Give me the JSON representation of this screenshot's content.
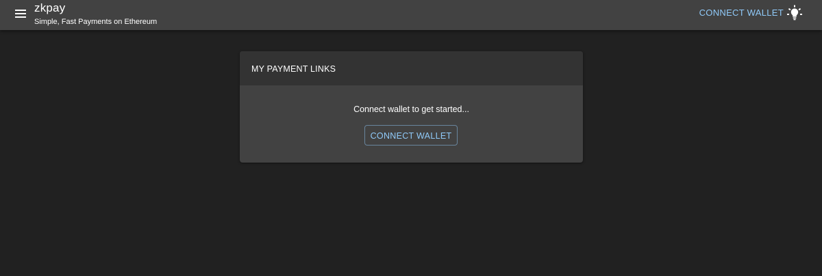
{
  "app": {
    "title": "zkpay",
    "subtitle": "Simple, Fast Payments on Ethereum"
  },
  "header": {
    "menu_icon": "hamburger-menu-icon",
    "connect_label": "CONNECT WALLET",
    "theme_icon": "lightbulb-icon"
  },
  "card": {
    "title": "MY PAYMENT LINKS",
    "prompt": "Connect wallet to get started...",
    "connect_label": "CONNECT WALLET"
  },
  "colors": {
    "background": "#212121",
    "appbar": "#424242",
    "card": "#424242",
    "card_header": "#333333",
    "accent": "#90caf9",
    "text": "#ffffff"
  }
}
